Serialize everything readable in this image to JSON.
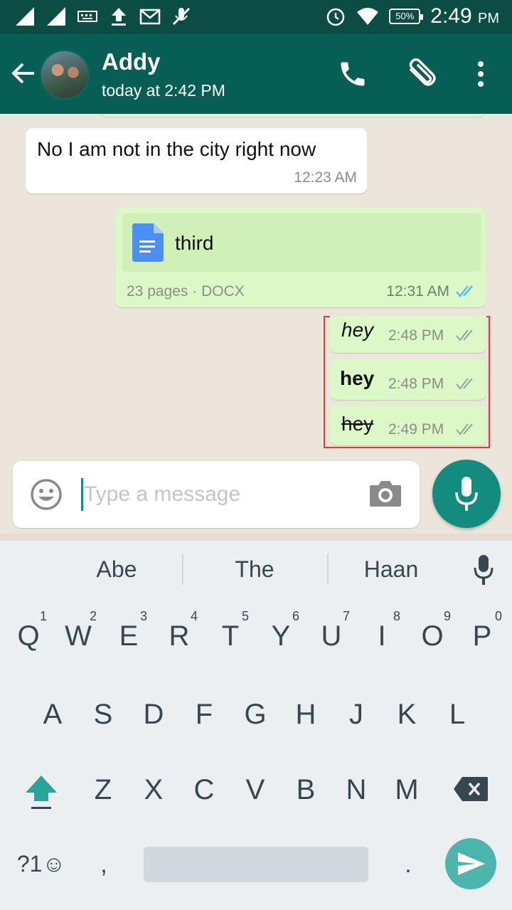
{
  "status_bar": {
    "battery": "50%",
    "time": "2:49",
    "ampm": "PM"
  },
  "contact": {
    "name": "Addy",
    "status": "today at 2:42 PM"
  },
  "messages": [
    {
      "text": "No I am not in the city right now",
      "time": "12:23 AM"
    },
    {
      "doc_name": "third",
      "doc_info": "23 pages · DOCX",
      "time": "12:31 AM"
    },
    {
      "text": "hey",
      "time": "2:48 PM",
      "style": "italic"
    },
    {
      "text": "hey",
      "time": "2:48 PM",
      "style": "bold"
    },
    {
      "text": "hey",
      "time": "2:49 PM",
      "style": "strikethrough"
    }
  ],
  "input": {
    "placeholder": "Type a message"
  },
  "keyboard": {
    "suggestions": [
      "Abe",
      "The",
      "Haan"
    ],
    "row1": [
      "Q",
      "W",
      "E",
      "R",
      "T",
      "Y",
      "U",
      "I",
      "O",
      "P"
    ],
    "row1_hints": [
      "1",
      "2",
      "3",
      "4",
      "5",
      "6",
      "7",
      "8",
      "9",
      "0"
    ],
    "row2": [
      "A",
      "S",
      "D",
      "F",
      "G",
      "H",
      "J",
      "K",
      "L"
    ],
    "row3": [
      "Z",
      "X",
      "C",
      "V",
      "B",
      "N",
      "M"
    ],
    "symbols_label": "?1☺",
    "comma": ",",
    "period": "."
  },
  "colors": {
    "header": "#075e54",
    "statusbar": "#0b4d45",
    "outgoing": "#dcf8c6",
    "accent": "#128c7e",
    "tick_read": "#4fc3f7",
    "highlight_box": "#e53935"
  }
}
